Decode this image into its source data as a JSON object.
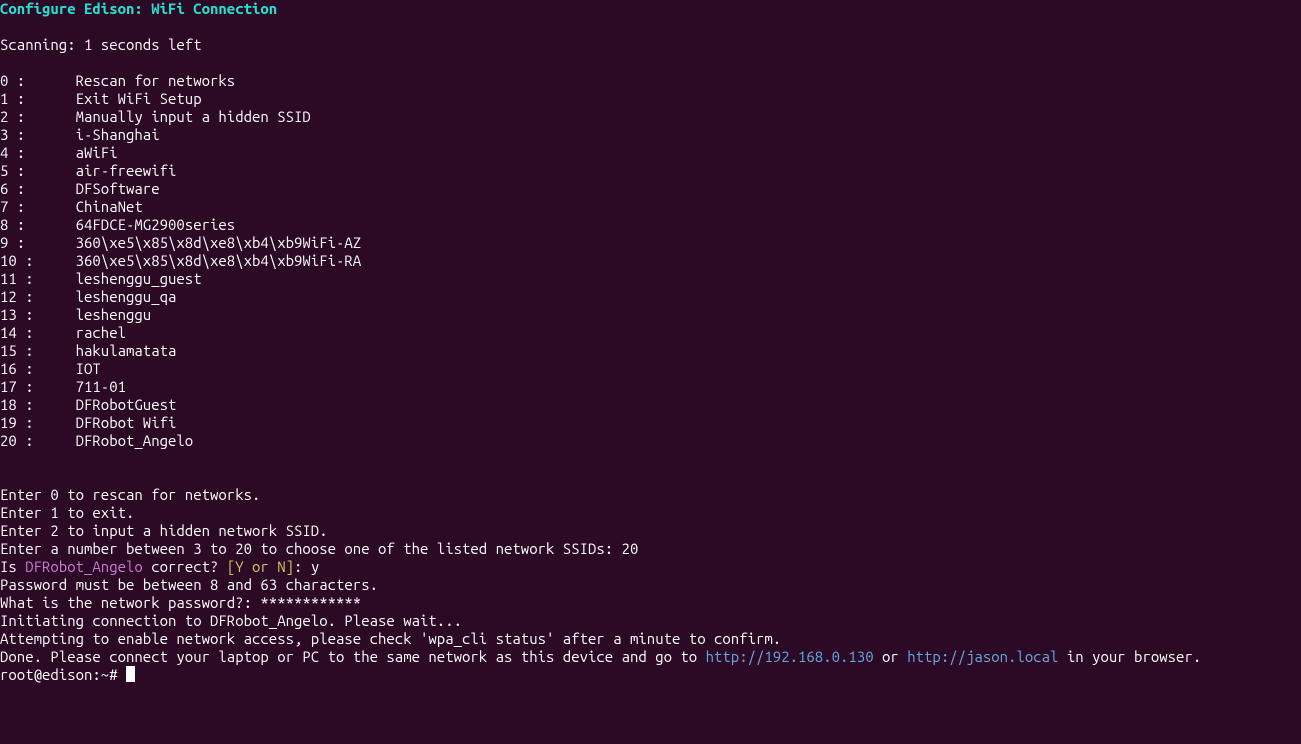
{
  "heading": "Configure Edison: WiFi Connection",
  "scanning": "Scanning: 1 seconds left",
  "options": [
    {
      "idx": "0",
      "label": "Rescan for networks"
    },
    {
      "idx": "1",
      "label": "Exit WiFi Setup"
    },
    {
      "idx": "2",
      "label": "Manually input a hidden SSID"
    },
    {
      "idx": "3",
      "label": "i-Shanghai"
    },
    {
      "idx": "4",
      "label": "aWiFi"
    },
    {
      "idx": "5",
      "label": "air-freewifi"
    },
    {
      "idx": "6",
      "label": "DFSoftware"
    },
    {
      "idx": "7",
      "label": "ChinaNet"
    },
    {
      "idx": "8",
      "label": "64FDCE-MG2900series"
    },
    {
      "idx": "9",
      "label": "360\\xe5\\x85\\x8d\\xe8\\xb4\\xb9WiFi-AZ"
    },
    {
      "idx": "10",
      "label": "360\\xe5\\x85\\x8d\\xe8\\xb4\\xb9WiFi-RA"
    },
    {
      "idx": "11",
      "label": "leshenggu_guest"
    },
    {
      "idx": "12",
      "label": "leshenggu_qa"
    },
    {
      "idx": "13",
      "label": "leshenggu"
    },
    {
      "idx": "14",
      "label": "rachel"
    },
    {
      "idx": "15",
      "label": "hakulamatata"
    },
    {
      "idx": "16",
      "label": "IOT"
    },
    {
      "idx": "17",
      "label": "711-01"
    },
    {
      "idx": "18",
      "label": "DFRobotGuest"
    },
    {
      "idx": "19",
      "label": "DFRobot Wifi"
    },
    {
      "idx": "20",
      "label": "DFRobot_Angelo"
    }
  ],
  "hint0": "Enter 0 to rescan for networks.",
  "hint1": "Enter 1 to exit.",
  "hint2": "Enter 2 to input a hidden network SSID.",
  "hint3": "Enter a number between 3 to 20 to choose one of the listed network SSIDs: 20",
  "confirm_pre": "Is ",
  "confirm_ssid": "DFRobot_Angelo",
  "confirm_mid": " correct? ",
  "confirm_choice": "[Y or N]",
  "confirm_post": ": y",
  "passrule": "Password must be between 8 and 63 characters.",
  "passprompt": "What is the network password?: ************",
  "init": "Initiating connection to DFRobot_Angelo. Please wait...",
  "attempt": "Attempting to enable network access, please check 'wpa_cli status' after a minute to confirm.",
  "done_pre": "Done. Please connect your laptop or PC to the same network as this device and go to ",
  "url1": "http://192.168.0.130",
  "done_mid": " or ",
  "url2": "http://jason.local",
  "done_post": " in your browser.",
  "prompt": "root@edison:~# "
}
